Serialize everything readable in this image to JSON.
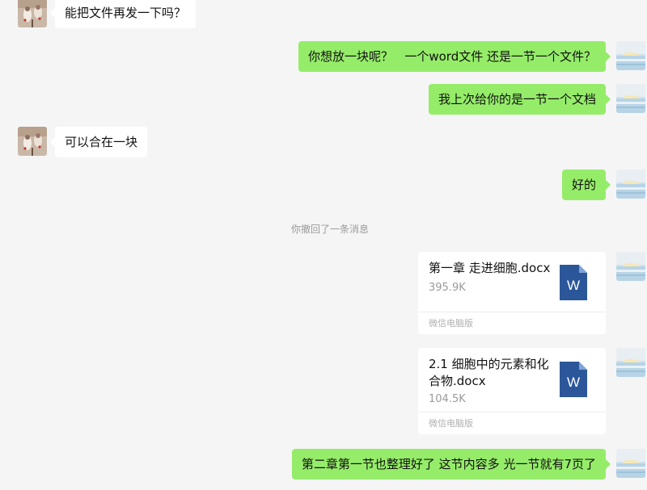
{
  "messages": [
    {
      "side": "in",
      "type": "text",
      "text": "能把文件再发一下吗？"
    },
    {
      "side": "out",
      "type": "text",
      "text": "你想放一块呢？   一个word文件 还是一节一个文件？"
    },
    {
      "side": "out",
      "type": "text",
      "text": "我上次给你的是一节一个文档"
    },
    {
      "side": "in",
      "type": "text",
      "text": "可以合在一块"
    },
    {
      "side": "out",
      "type": "text",
      "text": "好的"
    },
    {
      "type": "notice",
      "text": "你撤回了一条消息"
    },
    {
      "side": "out",
      "type": "file",
      "name": "第一章 走进细胞.docx",
      "size": "395.9K",
      "source": "微信电脑版",
      "icon": "word-doc-icon"
    },
    {
      "side": "out",
      "type": "file",
      "name": "2.1 细胞中的元素和化合物.docx",
      "size": "104.5K",
      "source": "微信电脑版",
      "icon": "word-doc-icon"
    },
    {
      "side": "out",
      "type": "text",
      "text": "第二章第一节也整理好了 这节内容多 光一节就有7页了"
    }
  ],
  "icons": {
    "word_letter": "W",
    "word_color": "#2b579a"
  },
  "colors": {
    "outgoing_bubble": "#95ec69",
    "incoming_bubble": "#ffffff",
    "background": "#f5f5f5"
  }
}
